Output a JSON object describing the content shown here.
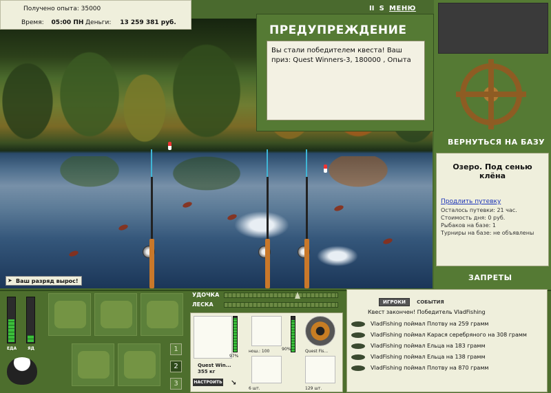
{
  "top_info": {
    "exp_label": "Получено опыта:",
    "exp_value": "35000",
    "time_label": "Время:",
    "time_value": "05:00 ПН",
    "money_label": "Деньги:",
    "money_value": "13 259 381 руб."
  },
  "top_icons": {
    "pause": "II",
    "sound": "S",
    "menu": "МЕНЮ"
  },
  "warning": {
    "title": "ПРЕДУПРЕЖДЕНИЕ",
    "text": "Вы стали победителем квеста! Ваш приз: Quest Winners-3, 180000 , Опыта"
  },
  "rank_notice": "Ваш разряд вырос!",
  "right_panel": {
    "return_button": "ВЕРНУТЬСЯ НА БАЗУ",
    "lake_name": "Озеро. Под сенью клёна",
    "extend_link": "Продлить путевку",
    "info_lines": [
      "Осталось путевки: 21 час.",
      "Стоимость дня: 0 руб.",
      "Рыбаков на базе: 1",
      "Турниры на базе: не объявлены"
    ],
    "bans_button": "ЗАПРЕТЫ"
  },
  "meters": {
    "food_label": "ЕДА",
    "poison_label": "ЯД",
    "food_level": 0.5,
    "poison_level": 0.15
  },
  "inventory_pages": [
    "1",
    "2",
    "3"
  ],
  "active_page": "2",
  "rod_controls": {
    "rod_label": "УДОЧКА",
    "line_label": "ЛЕСКА"
  },
  "gear": {
    "rod_name": "Quest Win...",
    "rod_weight": "355 кг",
    "rod_percent": "97%",
    "tune_button": "НАСТРОИТЬ",
    "reel_caption": "нош.: 100",
    "reel_percent": "90%",
    "line_caption": "Quest Fis...",
    "hook_count": "6 шт.",
    "bait_count": "129 шт.",
    "rod_wear": 0.97,
    "reel_wear": 0.9
  },
  "events": {
    "tabs": [
      "ИГРОКИ",
      "СОБЫТИЯ"
    ],
    "active_tab": "ИГРОКИ",
    "lines": [
      "Квест закончен! Победитель VladFishing",
      "VladFishing поймал Плотву на 259 грамм",
      "VladFishing поймал Карася серебряного на 308 грамм",
      "VladFishing поймал Ельца на 183 грамм",
      "VladFishing поймал Ельца на 138 грамм",
      "VladFishing поймал Плотву на 870 грамм"
    ]
  }
}
